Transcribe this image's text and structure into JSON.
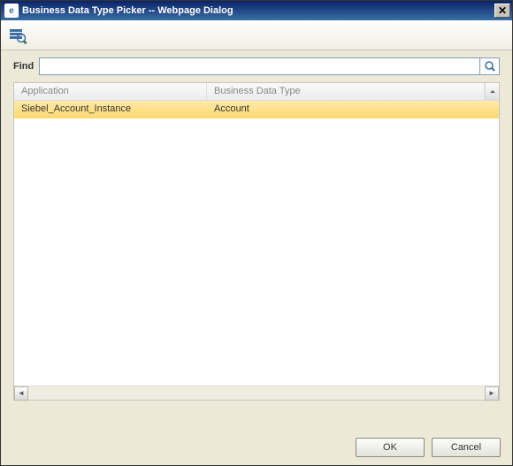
{
  "titlebar": {
    "title": "Business Data Type Picker -- Webpage Dialog"
  },
  "find": {
    "label": "Find",
    "value": "",
    "placeholder": ""
  },
  "list": {
    "columns": {
      "application": "Application",
      "bdt": "Business Data Type"
    },
    "rows": [
      {
        "application": "Siebel_Account_Instance",
        "bdt": "Account"
      }
    ]
  },
  "buttons": {
    "ok": "OK",
    "cancel": "Cancel"
  }
}
